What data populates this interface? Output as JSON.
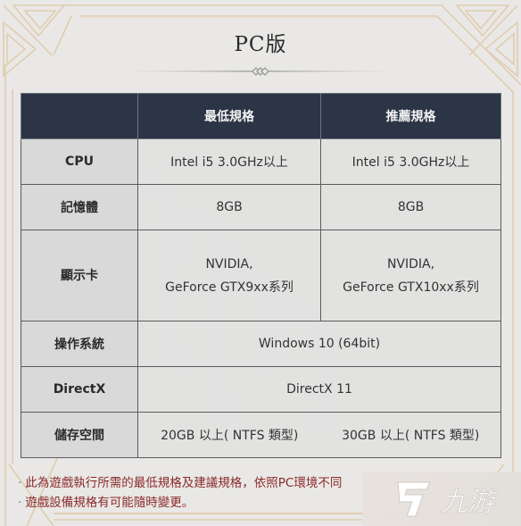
{
  "title": "PC版",
  "table": {
    "headers": [
      "",
      "最低規格",
      "推薦規格"
    ],
    "rows": [
      {
        "label": "CPU",
        "min": "Intel i5 3.0GHz以上",
        "rec": "Intel i5 3.0GHz以上"
      },
      {
        "label": "記憶體",
        "min": "8GB",
        "rec": "8GB"
      },
      {
        "label": "顯示卡",
        "min_line1": "NVIDIA,",
        "min_line2": "GeForce GTX9xx系列",
        "rec_line1": "NVIDIA,",
        "rec_line2": "GeForce GTX10xx系列"
      },
      {
        "label": "操作系統",
        "value": "Windows 10 (64bit)"
      },
      {
        "label": "DirectX",
        "value": "DirectX 11"
      },
      {
        "label": "儲存空間",
        "min": "20GB 以上( NTFS 類型)",
        "rec": "30GB 以上( NTFS 類型)"
      }
    ]
  },
  "notes": [
    "此為遊戲執行所需的最低規格及建議規格，依照PC環境不同",
    "遊戲設備規格有可能隨時變更。"
  ],
  "note_bullet": "·",
  "watermark": {
    "brand": "九游",
    "icon": "jiuyou-logo-icon"
  },
  "colors": {
    "header_bg": "#2c3545",
    "note_text": "#8b2a2a",
    "frame_gold": "#dcc7a6"
  }
}
